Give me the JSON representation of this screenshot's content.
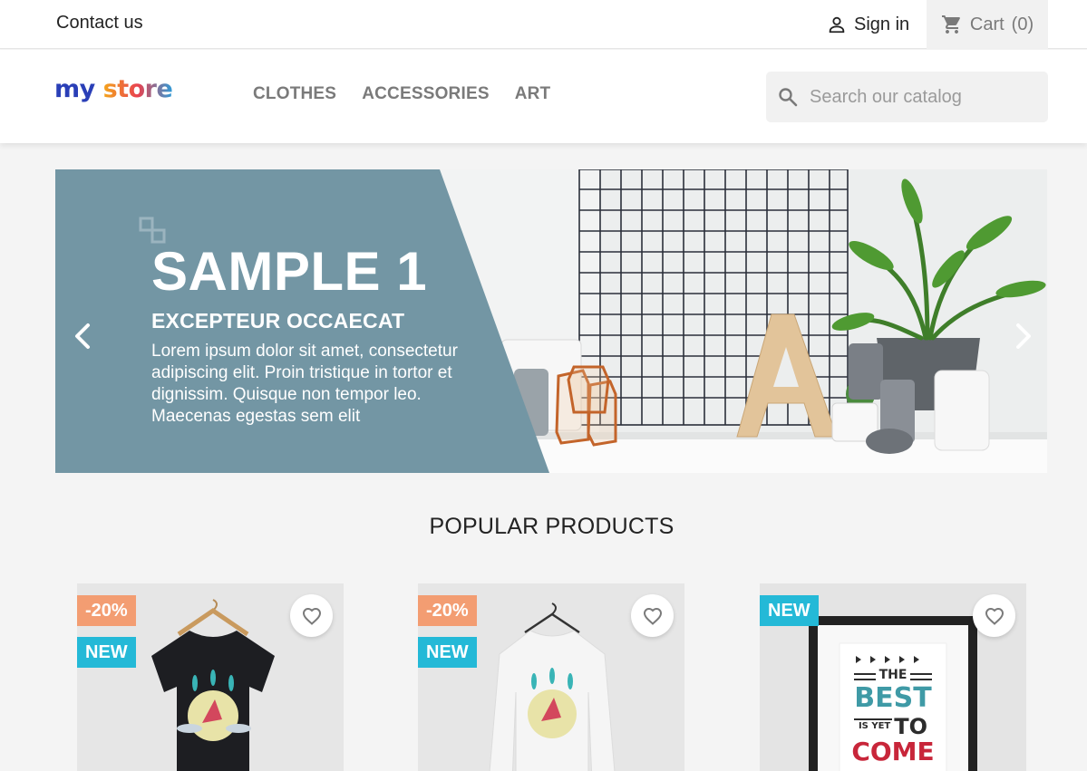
{
  "topbar": {
    "contact_label": "Contact us",
    "signin_label": "Sign in",
    "cart_label": "Cart",
    "cart_count": "(0)",
    "signin_icon": "user-icon",
    "cart_icon": "cart-icon"
  },
  "header": {
    "logo": {
      "word1": "my",
      "word2": "store"
    },
    "nav": [
      "CLOTHES",
      "ACCESSORIES",
      "ART"
    ],
    "search": {
      "placeholder": "Search our catalog",
      "icon": "search-icon"
    }
  },
  "carousel": {
    "title": "SAMPLE 1",
    "subtitle": "EXCEPTEUR OCCAECAT",
    "description": "Lorem ipsum dolor sit amet, consectetur adipiscing elit. Proin tristique in tortor et dignissim. Quisque non tempor leo. Maecenas egestas sem elit",
    "prev_icon": "chevron-left-icon",
    "next_icon": "chevron-right-icon"
  },
  "section": {
    "title": "POPULAR PRODUCTS"
  },
  "products": [
    {
      "flags": [
        "-20%",
        "NEW"
      ],
      "image": "black-tshirt-hummingbird"
    },
    {
      "flags": [
        "-20%",
        "NEW"
      ],
      "image": "white-sweater-hummingbird"
    },
    {
      "flags": [
        "NEW"
      ],
      "image": "poster-the-best-is-yet-to-come",
      "poster_lines": [
        "THE",
        "BEST",
        "IS YET",
        "TO",
        "COME"
      ]
    }
  ],
  "colors": {
    "slide_panel": "#7396a4",
    "discount_flag": "#f39d72",
    "new_flag": "#24b9d7",
    "nav_text": "#7a7a7a"
  }
}
